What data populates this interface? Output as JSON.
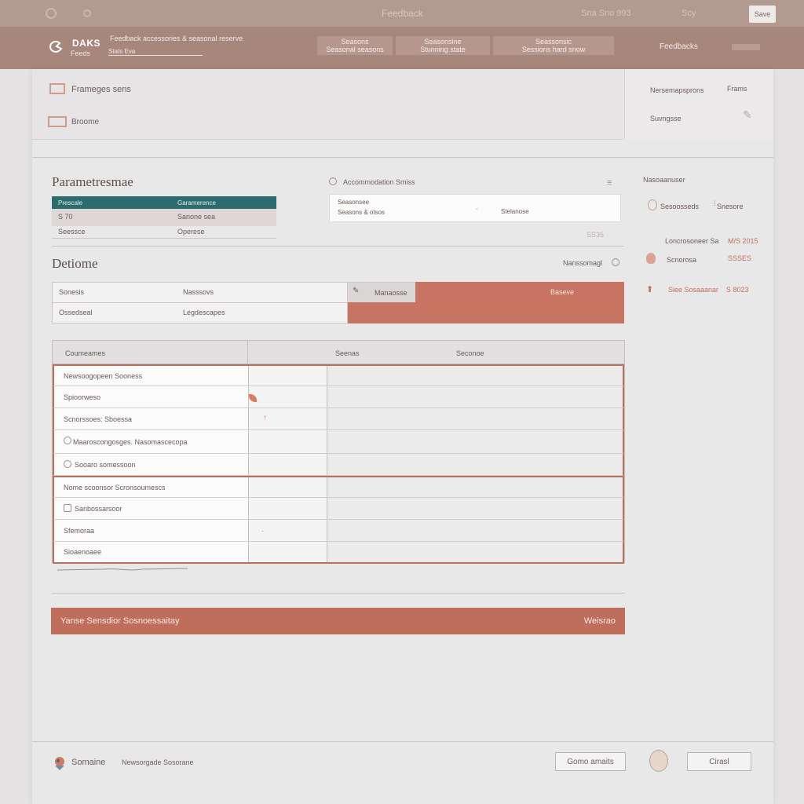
{
  "topbar": {
    "center": "Feedback",
    "right1": "Sna  Sno 993",
    "right2": "Scy",
    "button": "Save"
  },
  "header": {
    "logo_title": "DAKS",
    "logo_sub": "Feeds",
    "sub1": "Feedback accessories & seasonal reserve",
    "sub2": "Stats Eva",
    "block1": "Seasons",
    "block1_sub": "Seasonal seasons",
    "block2": "Seasonsine",
    "block2_sub": "Stunning state",
    "block3": "Seassonsic",
    "block3_sub": "Sessions hard snow",
    "right": "Feedbacks"
  },
  "section1": {
    "row1": "Frameges sens",
    "row2": "Broome",
    "right_label": "Nersemapsprons",
    "right_label2": "Frams",
    "right_sub": "Suvngsse"
  },
  "parameters": {
    "title": "Parametresmae",
    "table_head": [
      "Prescale",
      "Garamerence"
    ],
    "row1": [
      "S 70",
      "Sanone sea"
    ],
    "row2": [
      "Seessce",
      "Operese"
    ],
    "select_label": "Accommodation Smiss",
    "select_line1": "Seasonsee",
    "select_line2": "Seasons & otsos",
    "select_value": "Stelanose",
    "side_value": "SS35"
  },
  "details": {
    "title": "Detiome",
    "link": "Nanssomagl",
    "field1": "Sonesis",
    "field1_value": "Nasssovs",
    "field2": "Ossedseal",
    "field2_value": "Legdescapes",
    "mid": "Manaosse",
    "accent": "Baseve"
  },
  "grid": {
    "headers": [
      "Coumeames",
      "Seenas",
      "Seconoe"
    ],
    "rows": [
      "Newsoogopeen Sooness",
      "Spioorweso",
      "Scnorssoes: Sboessa",
      "Maaroscongosges. Nasomascecopa",
      "Sooaro somessoon",
      "Nome scoonsor Scronsoumescs",
      "Sanbossarsoor",
      "Sfemoraa",
      "Sioaenoaee"
    ]
  },
  "banner": {
    "left": "Yanse Sensdior Sosnoessaitay",
    "right": "Weisrao"
  },
  "footer": {
    "brand": "Somaine",
    "sub": "Newsorgade Sosorane",
    "btn1": "Gomo amaits",
    "btn2": "Cirasl"
  },
  "sidebar": {
    "title": "Nasoaanuser",
    "items": [
      {
        "label": "Sesoosseds",
        "value": "Snesore"
      },
      {
        "label": "Loncrosoneer Sa",
        "value": "M/S 2015"
      },
      {
        "label": "Scnorosa",
        "value": "SSSES"
      },
      {
        "label": "Siee Sosaaanar",
        "value": "S 8023"
      }
    ]
  },
  "colors": {
    "accent": "#c06e5c",
    "teal": "#2d6b6f",
    "header": "#a7867c"
  }
}
